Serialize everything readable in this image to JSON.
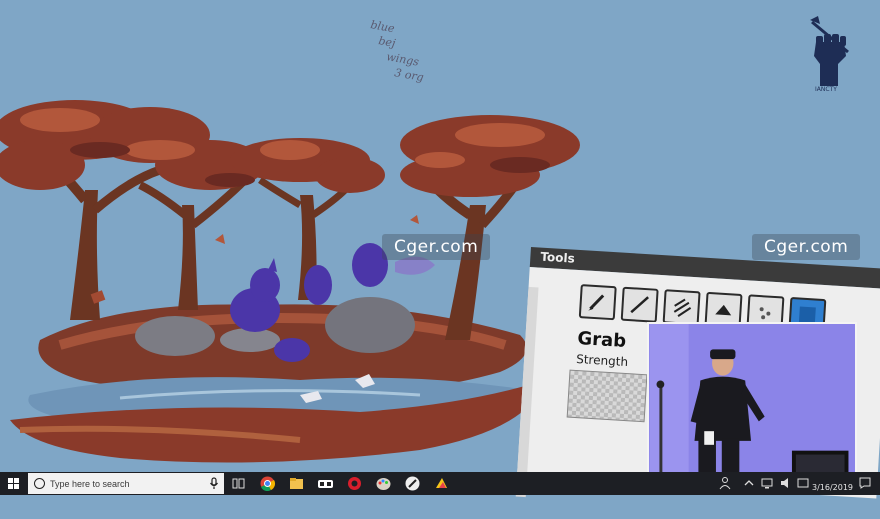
{
  "watermarks": [
    "Cger.com",
    "Cger.com"
  ],
  "handwriting": [
    "blue",
    "bej",
    "wings",
    "3 org"
  ],
  "logo_text": "IANCTY",
  "tools_panel": {
    "title": "Tools",
    "selected_tool": "Grab",
    "strength_label": "Strength",
    "tool_icons": [
      "brush-icon",
      "line-icon",
      "hatch-icon",
      "shape-icon",
      "texture-icon",
      "color-swatch-icon"
    ]
  },
  "taskbar": {
    "search_placeholder": "Type here to search",
    "pinned_icons": [
      "task-view-icon",
      "chrome-icon",
      "file-explorer-icon",
      "vr-headset-icon",
      "red-app-icon",
      "paint-palette-icon",
      "pen-app-icon",
      "yellow-app-icon"
    ],
    "date": "3/16/2019"
  },
  "colors": {
    "sky": "#7fa6c6",
    "foliage": "#8a3a2a",
    "trunk": "#6b3522",
    "creatures": "#4b36a8",
    "taskbar": "#1d1f24",
    "camera_bg": "#8b84e8"
  }
}
